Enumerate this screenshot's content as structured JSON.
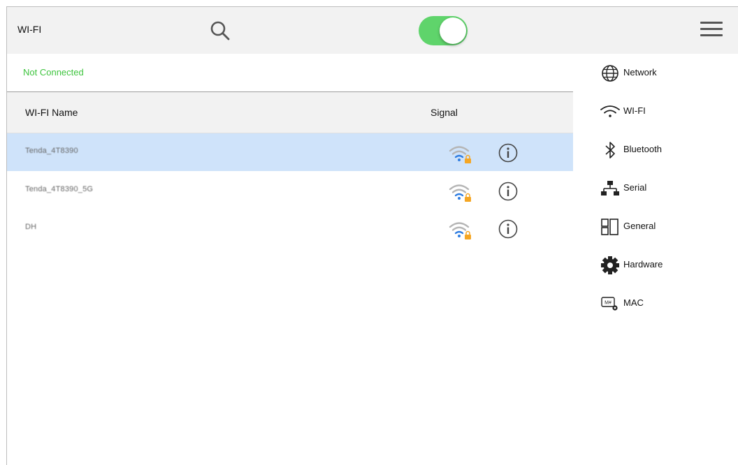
{
  "header": {
    "title": "WI-FI",
    "wifi_enabled": true,
    "accent_color": "#5fd46b"
  },
  "status": {
    "text": "Not Connected",
    "color": "#3ec43e"
  },
  "list": {
    "columns": {
      "name": "WI-FI Name",
      "signal": "Signal"
    },
    "rows": [
      {
        "name": "Tenda_4T8390",
        "selected": true,
        "signal_icon": "wifi-lock-icon"
      },
      {
        "name": "Tenda_4T8390_5G",
        "selected": false,
        "signal_icon": "wifi-lock-icon"
      },
      {
        "name": "DH",
        "selected": false,
        "signal_icon": "wifi-lock-icon"
      }
    ]
  },
  "sidebar": {
    "items": [
      {
        "label": "Network",
        "icon": "globe-icon"
      },
      {
        "label": "WI-FI",
        "icon": "wifi-icon"
      },
      {
        "label": "Bluetooth",
        "icon": "bluetooth-icon"
      },
      {
        "label": "Serial",
        "icon": "serial-icon"
      },
      {
        "label": "General",
        "icon": "general-icon"
      },
      {
        "label": "Hardware",
        "icon": "gear-icon"
      },
      {
        "label": "MAC",
        "icon": "mac-icon"
      }
    ]
  }
}
